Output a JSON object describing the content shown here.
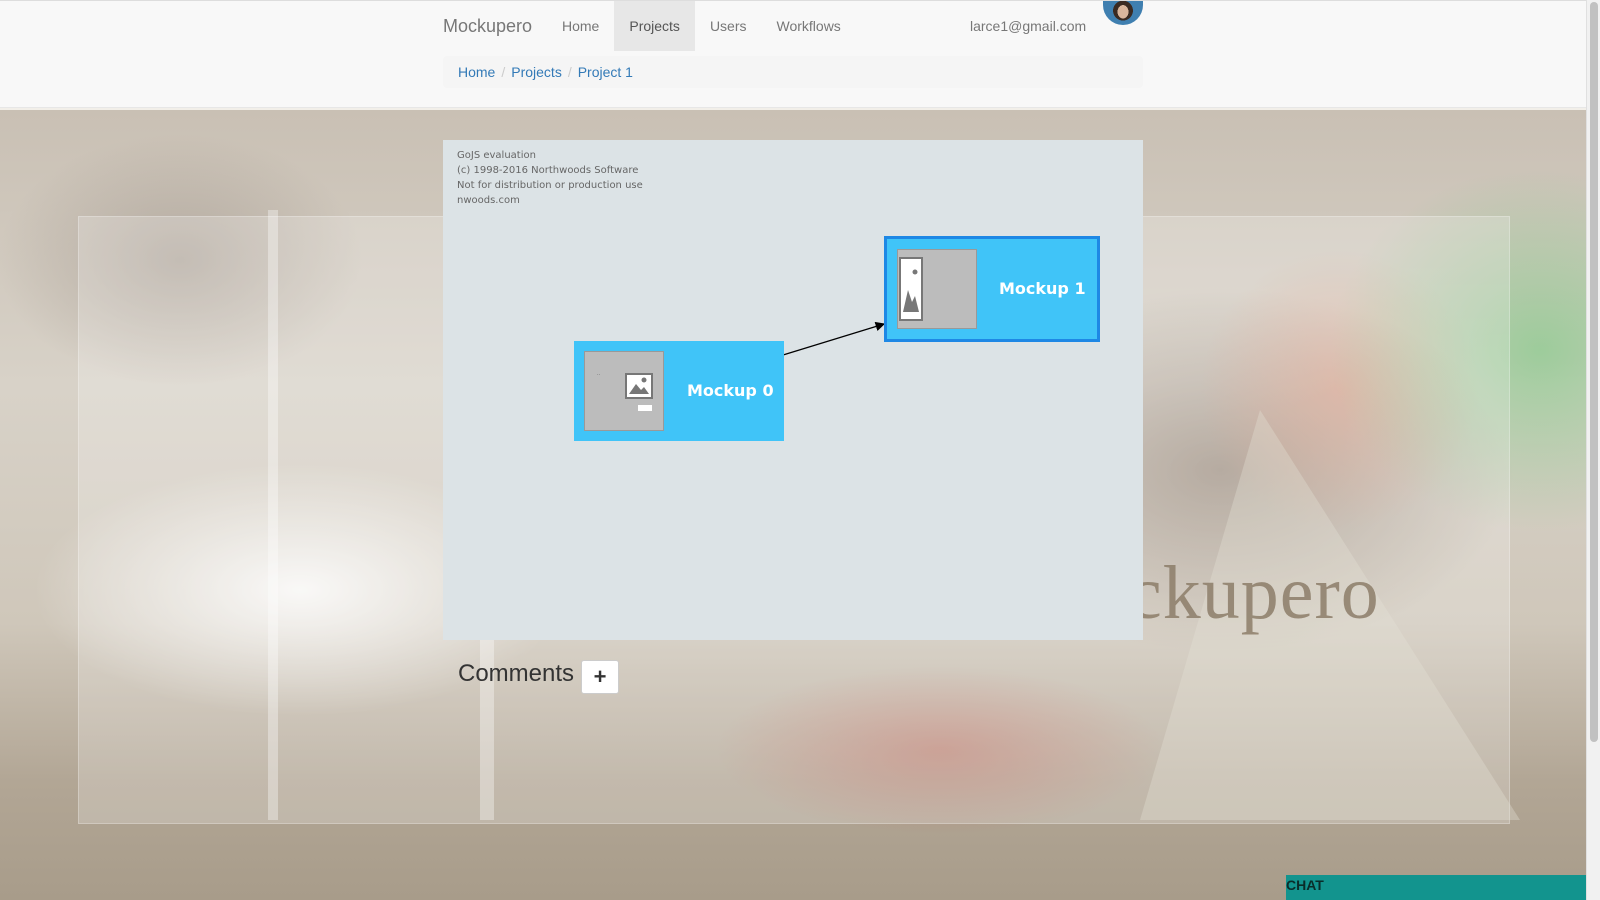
{
  "navbar": {
    "brand": "Mockupero",
    "items": [
      {
        "label": "Home",
        "active": false
      },
      {
        "label": "Projects",
        "active": true
      },
      {
        "label": "Users",
        "active": false
      },
      {
        "label": "Workflows",
        "active": false
      }
    ],
    "user_email": "larce1@gmail.com",
    "avatar_icon": "user-avatar-icon"
  },
  "breadcrumb": {
    "items": [
      "Home",
      "Projects",
      "Project 1"
    ],
    "separator": "/"
  },
  "diagram": {
    "watermark": [
      "GoJS evaluation",
      "(c) 1998-2016 Northwoods Software",
      "Not for distribution or production use",
      "nwoods.com"
    ],
    "nodes": [
      {
        "label": "Mockup 0",
        "selected": false
      },
      {
        "label": "Mockup 1",
        "selected": true
      }
    ],
    "link": {
      "from": "Mockup 0",
      "to": "Mockup 1"
    },
    "node_color": "#40c4f8",
    "selection_color": "#1e88e5",
    "background_color": "#dce3e6"
  },
  "background": {
    "brand_text": "ckupero"
  },
  "comments": {
    "title": "Comments",
    "add_label": "+"
  },
  "chat": {
    "label": "CHAT",
    "color": "#12948e"
  }
}
